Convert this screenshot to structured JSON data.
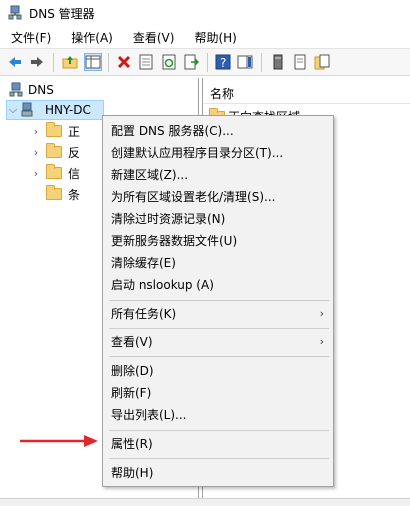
{
  "window": {
    "title": "DNS 管理器"
  },
  "menubar": {
    "items": [
      {
        "label": "文件(F)"
      },
      {
        "label": "操作(A)"
      },
      {
        "label": "查看(V)"
      },
      {
        "label": "帮助(H)"
      }
    ]
  },
  "tree": {
    "root": "DNS",
    "server": "HNY-DC",
    "children": [
      "正",
      "反",
      "信",
      "条"
    ]
  },
  "right_pane": {
    "column_header": "名称",
    "rows": [
      "正向查找区域"
    ]
  },
  "context_menu": {
    "items": [
      {
        "label": "配置 DNS 服务器(C)...",
        "submenu": ""
      },
      {
        "label": "创建默认应用程序目录分区(T)...",
        "submenu": ""
      },
      {
        "label": "新建区域(Z)...",
        "submenu": ""
      },
      {
        "label": "为所有区域设置老化/清理(S)...",
        "submenu": ""
      },
      {
        "label": "清除过时资源记录(N)",
        "submenu": ""
      },
      {
        "label": "更新服务器数据文件(U)",
        "submenu": ""
      },
      {
        "label": "清除缓存(E)",
        "submenu": ""
      },
      {
        "label": "启动 nslookup (A)",
        "submenu": ""
      },
      {
        "label": "所有任务(K)",
        "submenu": "›"
      },
      {
        "label": "查看(V)",
        "submenu": "›"
      },
      {
        "label": "删除(D)",
        "submenu": ""
      },
      {
        "label": "刷新(F)",
        "submenu": ""
      },
      {
        "label": "导出列表(L)...",
        "submenu": ""
      },
      {
        "label": "属性(R)",
        "submenu": ""
      },
      {
        "label": "帮助(H)",
        "submenu": ""
      }
    ]
  },
  "colors": {
    "annotation_arrow": "#e0272c",
    "selection_bg": "#cce8ff",
    "menu_bg": "#f2f2f2"
  }
}
